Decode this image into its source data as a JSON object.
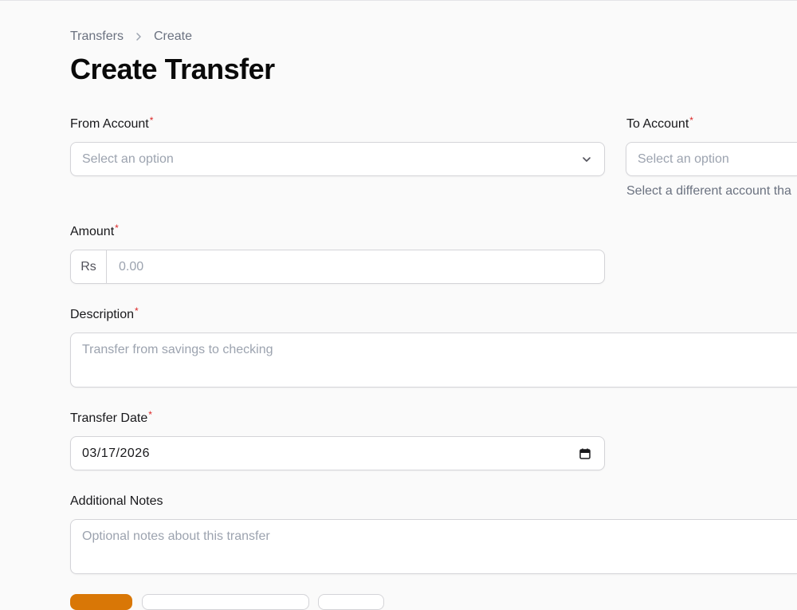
{
  "breadcrumb": {
    "parent": "Transfers",
    "current": "Create"
  },
  "page": {
    "title": "Create Transfer"
  },
  "form": {
    "from_account": {
      "label": "From Account",
      "required_mark": "*",
      "placeholder": "Select an option"
    },
    "to_account": {
      "label": "To Account",
      "required_mark": "*",
      "placeholder": "Select an option",
      "helper": "Select a different account tha"
    },
    "amount": {
      "label": "Amount",
      "required_mark": "*",
      "prefix": "Rs",
      "placeholder": "0.00"
    },
    "description": {
      "label": "Description",
      "required_mark": "*",
      "placeholder": "Transfer from savings to checking"
    },
    "transfer_date": {
      "label": "Transfer Date",
      "required_mark": "*",
      "value": "03/17/2026"
    },
    "notes": {
      "label": "Additional Notes",
      "placeholder": "Optional notes about this transfer"
    }
  },
  "colors": {
    "primary": "#d97706",
    "required": "#dc2626"
  }
}
